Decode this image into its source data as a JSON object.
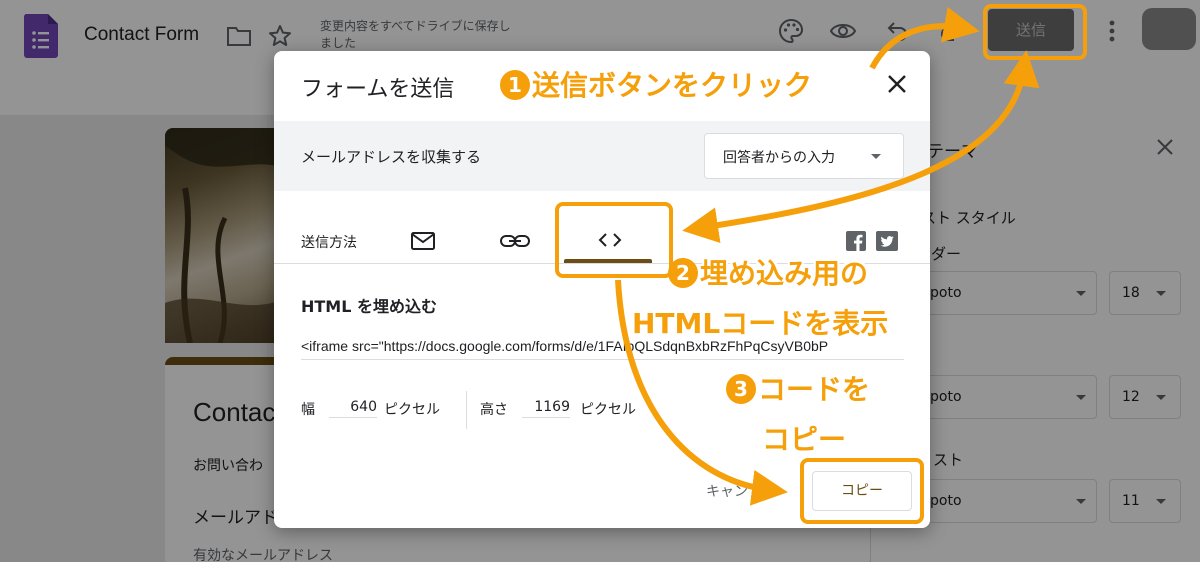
{
  "topbar": {
    "title": "Contact Form",
    "save_status": "変更内容をすべてドライブに保存しました",
    "send_label": "送信",
    "icons": [
      "forms-logo-icon",
      "folder-icon",
      "star-icon",
      "palette-icon",
      "eye-icon",
      "undo-icon",
      "redo-icon",
      "more-vert-icon"
    ]
  },
  "form": {
    "heading": "Contac",
    "description": "お問い合わ",
    "email_label": "メールアド",
    "email_hint": "有効なメールアドレス"
  },
  "theme_panel": {
    "title": "テーマ",
    "text_style_label": "スト スタイル",
    "header_label": "ダー",
    "text_label": "スト",
    "fonts": [
      {
        "font": "poto",
        "size": "18"
      },
      {
        "font": "poto",
        "size": "12"
      },
      {
        "font": "poto",
        "size": "11"
      }
    ]
  },
  "dialog": {
    "title": "フォームを送信",
    "collect_email_label": "メールアドレスを収集する",
    "collect_email_value": "回答者からの入力",
    "send_via_label": "送信方法",
    "embed_tab_glyph": "<>",
    "embed_heading": "HTML を埋め込む",
    "embed_code": "<iframe src=\"https://docs.google.com/forms/d/e/1FAIpQLSdqnBxbRzFhPqCsyVB0bP",
    "width_label": "幅",
    "width_value": "640",
    "width_unit": "ピクセル",
    "height_label": "高さ",
    "height_value": "1169",
    "height_unit": "ピクセル",
    "cancel_label": "キャン",
    "copy_label": "コピー"
  },
  "annotations": {
    "step1_num": "1",
    "step1_text": "送信ボタンをクリック",
    "step2_num": "2",
    "step2_line1": "埋め込み用の",
    "step2_line2": "HTMLコードを表示",
    "step3_num": "3",
    "step3_line1": "コードを",
    "step3_line2": "コピー",
    "color": "#f5a00a"
  },
  "colors": {
    "accent": "#6b4e14",
    "overlay": "rgba(0,0,0,0.42)"
  }
}
